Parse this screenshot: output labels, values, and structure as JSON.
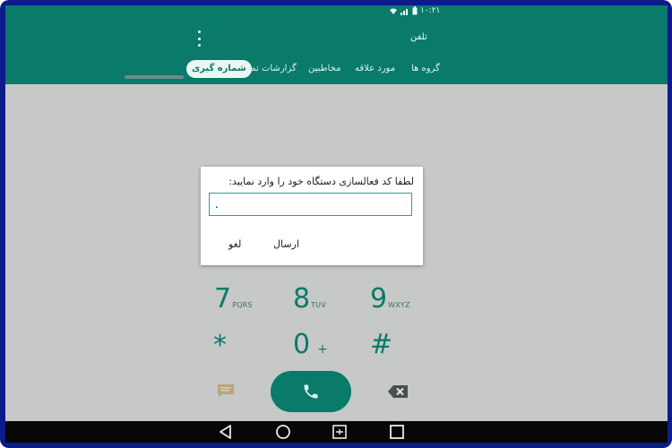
{
  "status_bar": {
    "time": "۱۰:۲۱"
  },
  "app": {
    "title": "تلفن"
  },
  "tabs": [
    {
      "label": "شماره گیری",
      "active": true
    },
    {
      "label": "گزارشات تماس",
      "active": false
    },
    {
      "label": "مخاطبین",
      "active": false
    },
    {
      "label": "مورد علاقه",
      "active": false
    },
    {
      "label": "گروه ها",
      "active": false
    }
  ],
  "keypad": {
    "row1": [
      {
        "digit": "7",
        "letters": "PQRS"
      },
      {
        "digit": "8",
        "letters": "TUV"
      },
      {
        "digit": "9",
        "letters": "WXYZ"
      }
    ],
    "row2": [
      {
        "digit": "*",
        "letters": ""
      },
      {
        "digit": "0",
        "letters": "+"
      },
      {
        "digit": "#",
        "letters": ""
      }
    ]
  },
  "dialog": {
    "title": "لطفا کد فعالسازی دستگاه خود را وارد نمایید:",
    "input_value": ".",
    "send_label": "ارسال",
    "cancel_label": "لغو"
  },
  "colors": {
    "primary": "#0a7a6a",
    "dim_background": "#c6c9c7"
  },
  "icons": [
    "menu-icon",
    "message-icon",
    "phone-icon",
    "backspace-icon",
    "back-icon",
    "home-icon",
    "recents-icon",
    "screenshot-icon"
  ]
}
